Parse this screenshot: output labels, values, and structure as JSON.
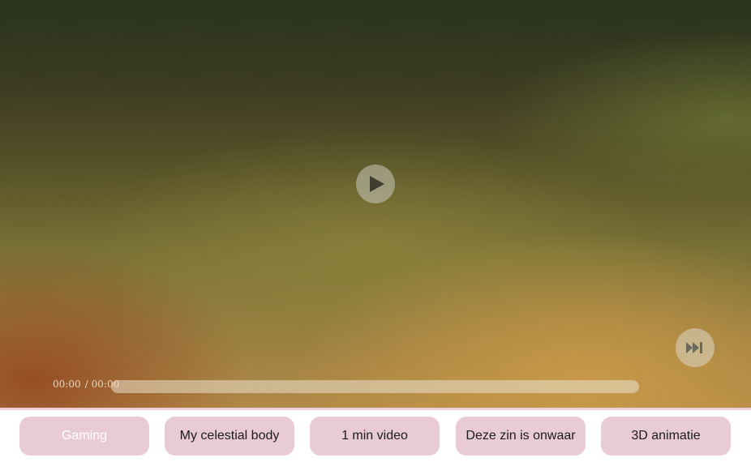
{
  "player": {
    "current_time": "00:00",
    "separator": "/",
    "duration": "00:00",
    "progress_fraction": 0,
    "play_icon": "play-icon",
    "skip_icon": "skip-forward-icon"
  },
  "tabs": [
    {
      "label": "Gaming",
      "active": true
    },
    {
      "label": "My celestial body",
      "active": false
    },
    {
      "label": "1 min video",
      "active": false
    },
    {
      "label": "Deze zin is onwaar",
      "active": false
    },
    {
      "label": "3D animatie",
      "active": false
    }
  ],
  "colors": {
    "tab_background": "#e8cbd3",
    "divider": "#ecd2d8",
    "active_tab_text": "#ffffff",
    "tab_text": "#1c1c1c"
  }
}
